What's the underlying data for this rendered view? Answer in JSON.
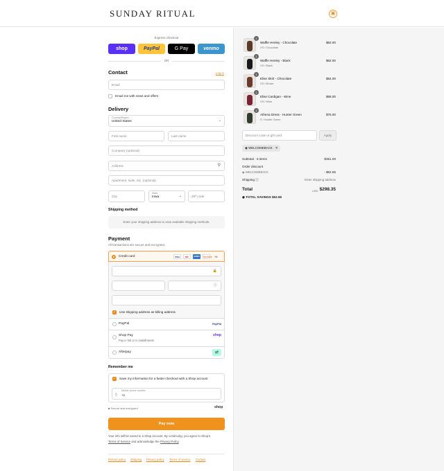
{
  "header": {
    "brand": "SUNDAY RITUAL",
    "cart_icon": "bag-icon"
  },
  "express": {
    "title": "Express checkout",
    "buttons": [
      "shop",
      "PayPal",
      "G Pay",
      "venmo"
    ],
    "colors": {
      "shop": "#5a31f4",
      "paypal": "#ffc439",
      "gpay": "#000000",
      "venmo": "#3d95ce"
    },
    "or": "OR"
  },
  "contact": {
    "title": "Contact",
    "login": "Log in",
    "email_placeholder": "Email",
    "news_label": "Email me with news and offers"
  },
  "delivery": {
    "title": "Delivery",
    "country_label": "Country/Region",
    "country_value": "United States",
    "first_name": "First name",
    "last_name": "Last name",
    "company": "Company (optional)",
    "address": "Address",
    "apartment": "Apartment, suite, etc. (optional)",
    "city": "City",
    "state_label": "State",
    "state_value": "Iowa",
    "zip": "ZIP code"
  },
  "shipping": {
    "title": "Shipping method",
    "message": "Enter your shipping address to view available shipping methods."
  },
  "payment": {
    "title": "Payment",
    "subtitle": "All transactions are secure and encrypted.",
    "credit_card_label": "Credit card",
    "card_logos": [
      "VISA",
      "MC",
      "AMEX",
      "DISCOVER"
    ],
    "more_cards": "+4",
    "billing_label": "Use shipping address as billing address",
    "paypal_label": "PayPal",
    "paypal_logo": "PayPal",
    "shoppay_label": "Shop Pay",
    "shoppay_sub": "Pay in full or in installments",
    "shoppay_logo": "shop",
    "afterpay_label": "Afterpay"
  },
  "remember": {
    "title": "Remember me",
    "save_label": "Save my information for a faster checkout with a Shop account",
    "phone_label": "Mobile phone number",
    "phone_value": "+1",
    "secure": "Secure and encrypted",
    "shop_logo": "shop"
  },
  "pay_button": "Pay now",
  "accent": "#f0921e",
  "legal": {
    "line1": "Your info will be saved to a Shop account. By continuing, you agree to Shop's",
    "tos": "Terms of Service",
    "and": "and acknowledge the",
    "privacy": "Privacy Policy",
    "dot": "."
  },
  "footer_links": [
    "Refund policy",
    "Shipping",
    "Privacy policy",
    "Terms of service",
    "Contact"
  ],
  "cart": {
    "items": [
      {
        "qty": "1",
        "name": "Waffle Henley - Chocolate",
        "variant": "XS / Chocolate",
        "price": "$62.00"
      },
      {
        "qty": "1",
        "name": "Waffle Henley - Black",
        "variant": "XS / Black",
        "price": "$62.00"
      },
      {
        "qty": "1",
        "name": "Elise Skirt - Chocolate",
        "variant": "XS / Brown",
        "price": "$64.00"
      },
      {
        "qty": "1",
        "name": "Elise Cardigan - Wine",
        "variant": "XS / Wine",
        "price": "$68.00"
      },
      {
        "qty": "1",
        "name": "Athena Dress - Hunter Green",
        "variant": "S / Hunter Green",
        "price": "$75.00"
      }
    ],
    "discount_placeholder": "Discount code or gift card",
    "apply": "Apply",
    "code_tag": "WELCOMEBACK",
    "subtotal_label": "Subtotal · 5 items",
    "subtotal_value": "$351.00",
    "order_discount_label": "Order discount",
    "order_discount_code": "WELCOMEBACK",
    "order_discount_value": "- $52.65",
    "shipping_label": "Shipping",
    "shipping_value": "Enter shipping address",
    "total_label": "Total",
    "currency": "USD",
    "total_value": "$298.35",
    "savings_label": "TOTAL SAVINGS",
    "savings_value": "$52.65"
  }
}
